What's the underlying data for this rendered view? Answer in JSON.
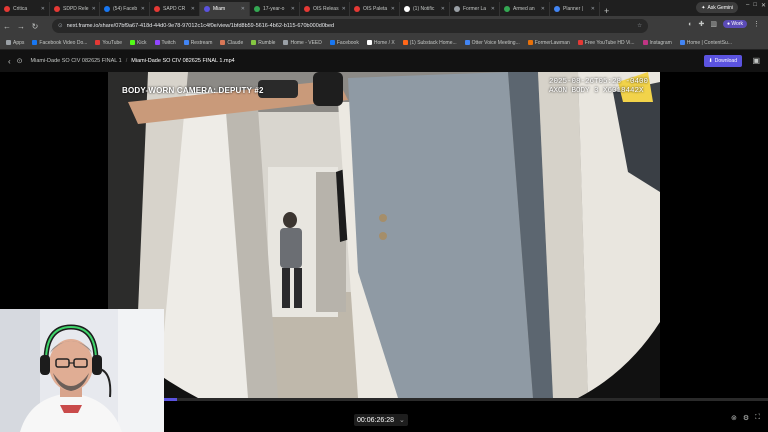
{
  "tabs": [
    {
      "label": "Critica",
      "color": "#e53935",
      "active": false
    },
    {
      "label": "SDPD Rele",
      "color": "#e53935",
      "active": false
    },
    {
      "label": "(54) Faceb",
      "color": "#1877f2",
      "active": false
    },
    {
      "label": "SAPD CR",
      "color": "#e53935",
      "active": false
    },
    {
      "label": "Miam",
      "color": "#5b53e0",
      "active": true
    },
    {
      "label": "17-year-o",
      "color": "#34a853",
      "active": false
    },
    {
      "label": "OIS Releas",
      "color": "#e53935",
      "active": false
    },
    {
      "label": "OIS Paleta",
      "color": "#e53935",
      "active": false
    },
    {
      "label": "(1) Notific",
      "color": "#ffffff",
      "active": false
    },
    {
      "label": "Former La",
      "color": "#9aa0a6",
      "active": false
    },
    {
      "label": "Armed an",
      "color": "#34a853",
      "active": false
    },
    {
      "label": "Planner |",
      "color": "#4285f4",
      "active": false
    }
  ],
  "new_tab": "+",
  "gemini_label": "Ask Gemini",
  "url": "next.frame.io/share/07bf9a67-418d-44d0-9e78-97012c1c4f0e/view/1bfd8b59-5616-4b62-b115-670b000d0bed",
  "profile_label": "Work",
  "bookmarks": [
    {
      "label": "Apps",
      "color": "#9aa0a6"
    },
    {
      "label": "Facebook Video Do...",
      "color": "#1877f2"
    },
    {
      "label": "YouTube",
      "color": "#e53935"
    },
    {
      "label": "Kick",
      "color": "#53fc18"
    },
    {
      "label": "Twitch",
      "color": "#9146ff"
    },
    {
      "label": "Restream",
      "color": "#4285f4"
    },
    {
      "label": "Claude",
      "color": "#d97757"
    },
    {
      "label": "Rumble",
      "color": "#85c742"
    },
    {
      "label": "Home - VEED",
      "color": "#9aa0a6"
    },
    {
      "label": "Facebook",
      "color": "#1877f2"
    },
    {
      "label": "Home / X",
      "color": "#ffffff"
    },
    {
      "label": "(1) Substack Home...",
      "color": "#ff6719"
    },
    {
      "label": "Otter Voice Meeting...",
      "color": "#4285f4"
    },
    {
      "label": "FormerLawman",
      "color": "#e8710a"
    },
    {
      "label": "Free YouTube HD Vi...",
      "color": "#e53935"
    },
    {
      "label": "Instagram",
      "color": "#c13584"
    },
    {
      "label": "Home | ContentSu...",
      "color": "#4285f4"
    }
  ],
  "header": {
    "breadcrumb_parent": "Miami-Dade SO CIV 082625 FINAL 1",
    "separator": "/",
    "file_name": "Miami-Dade SO CIV 082625 FINAL 1.mp4",
    "download_label": "Download"
  },
  "video": {
    "overlay_title": "BODY-WORN CAMERA: DEPUTY #2",
    "overlay_stamp_line1": "2025-08-26T05:28 -0400",
    "overlay_stamp_line2": "AXON BODY 3 X6018442X"
  },
  "player": {
    "timecode": "00:06:26:28",
    "progress_fraction": 0.23,
    "accent": "#5b53e0"
  }
}
